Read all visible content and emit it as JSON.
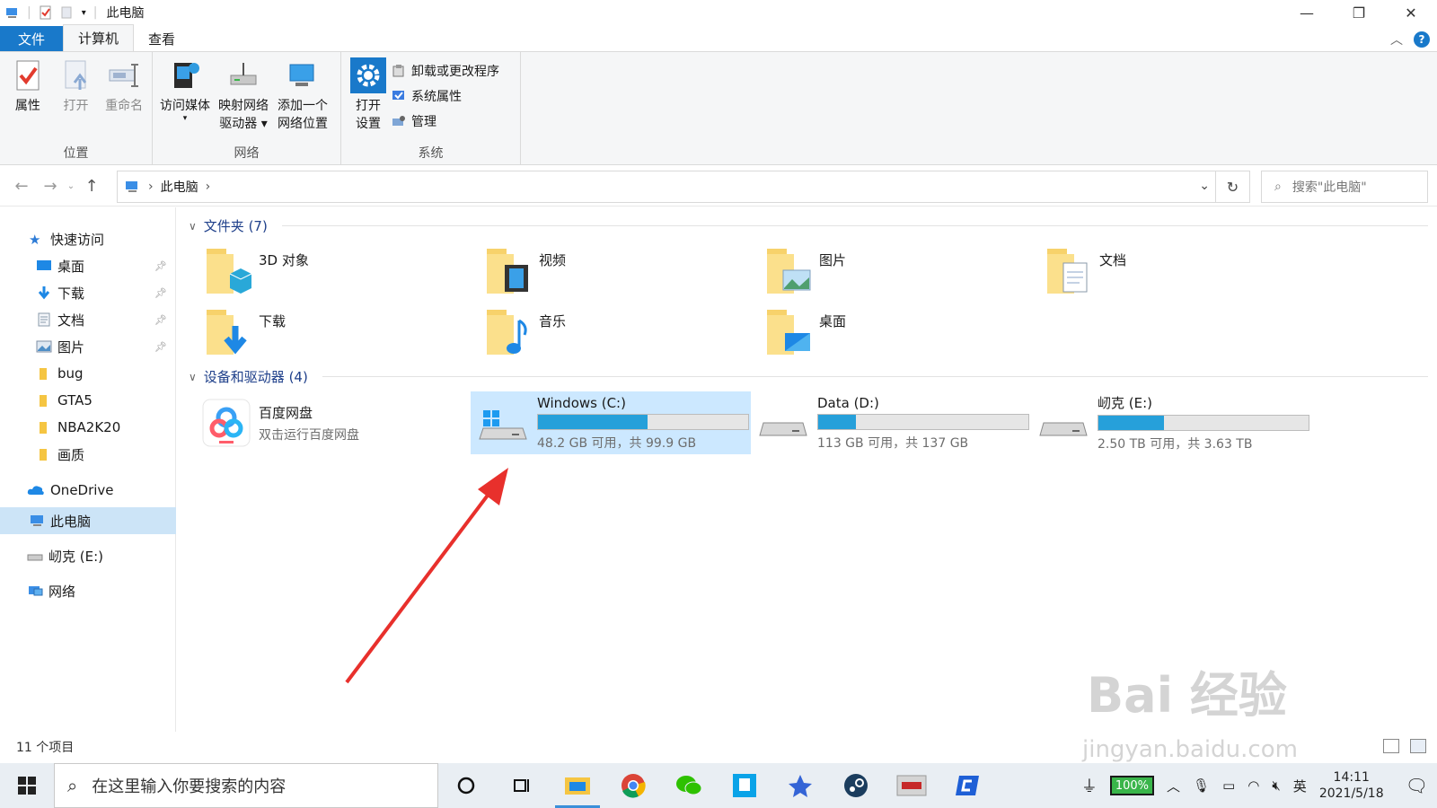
{
  "window": {
    "title": "此电脑",
    "controls": [
      "minimize",
      "restore",
      "close"
    ]
  },
  "ribbon_tabs": [
    {
      "label": "文件",
      "style": "file"
    },
    {
      "label": "计算机",
      "style": "active"
    },
    {
      "label": "查看",
      "style": "normal"
    }
  ],
  "ribbon": {
    "location": {
      "label": "位置",
      "buttons": [
        {
          "label": "属性",
          "icon": "properties-icon",
          "disabled": false
        },
        {
          "label": "打开",
          "icon": "open-icon",
          "disabled": true
        },
        {
          "label": "重命名",
          "icon": "rename-icon",
          "disabled": true
        }
      ]
    },
    "network": {
      "label": "网络",
      "buttons": [
        {
          "label": "访问媒体",
          "icon": "media-icon",
          "dropdown": true
        },
        {
          "label": "映射网络\n驱动器",
          "label_line1": "映射网络",
          "label_line2": "驱动器",
          "icon": "map-drive-icon",
          "dropdown": true
        },
        {
          "label_line1": "添加一个",
          "label_line2": "网络位置",
          "icon": "add-network-location-icon"
        }
      ]
    },
    "system": {
      "label": "系统",
      "open_settings_line1": "打开",
      "open_settings_line2": "设置",
      "items": [
        {
          "label": "卸载或更改程序",
          "icon": "uninstall-icon"
        },
        {
          "label": "系统属性",
          "icon": "system-properties-icon"
        },
        {
          "label": "管理",
          "icon": "manage-icon"
        }
      ]
    }
  },
  "address": {
    "path": "此电脑",
    "search_placeholder": "搜索\"此电脑\""
  },
  "sidebar": {
    "quick_access": "快速访问",
    "pinned": [
      {
        "label": "桌面",
        "icon": "desktop-icon",
        "pinned": true
      },
      {
        "label": "下载",
        "icon": "download-icon",
        "pinned": true
      },
      {
        "label": "文档",
        "icon": "documents-icon",
        "pinned": true
      },
      {
        "label": "图片",
        "icon": "pictures-icon",
        "pinned": true
      },
      {
        "label": "bug",
        "icon": "folder-icon",
        "pinned": false
      },
      {
        "label": "GTA5",
        "icon": "folder-icon",
        "pinned": false
      },
      {
        "label": "NBA2K20",
        "icon": "folder-icon",
        "pinned": false
      },
      {
        "label": "画质",
        "icon": "folder-icon",
        "pinned": false
      }
    ],
    "onedrive": "OneDrive",
    "this_pc": "此电脑",
    "drive_e": "屻克 (E:)",
    "network": "网络"
  },
  "folders_section": {
    "title": "文件夹 (7)",
    "items": [
      {
        "name": "3D 对象",
        "icon": "3d-objects-icon"
      },
      {
        "name": "视频",
        "icon": "videos-icon"
      },
      {
        "name": "图片",
        "icon": "pictures-icon"
      },
      {
        "name": "文档",
        "icon": "documents-icon"
      },
      {
        "name": "下载",
        "icon": "download-icon"
      },
      {
        "name": "音乐",
        "icon": "music-icon"
      },
      {
        "name": "桌面",
        "icon": "desktop-icon"
      }
    ]
  },
  "devices_section": {
    "title": "设备和驱动器 (4)",
    "baidu": {
      "name": "百度网盘",
      "subtitle": "双击运行百度网盘"
    },
    "drives": [
      {
        "name": "Windows (C:)",
        "free_text": "48.2 GB 可用，共 99.9 GB",
        "used_fraction": 0.52,
        "selected": true,
        "windows": true
      },
      {
        "name": "Data (D:)",
        "free_text": "113 GB 可用，共 137 GB",
        "used_fraction": 0.18,
        "selected": false,
        "windows": false
      },
      {
        "name": "屻克 (E:)",
        "free_text": "2.50 TB 可用，共 3.63 TB",
        "used_fraction": 0.31,
        "selected": false,
        "windows": false
      }
    ]
  },
  "status": {
    "count": "11 个项目"
  },
  "taskbar": {
    "search_placeholder": "在这里输入你要搜索的内容",
    "battery": "100%",
    "ime": "英",
    "time": "14:11",
    "date": "2021/5/18"
  },
  "watermark": {
    "line1": "Bai 经验",
    "line2": "jingyan.baidu.com"
  },
  "colors": {
    "accent": "#1979ca",
    "drive_bar": "#26a0da",
    "selection": "#cce8ff",
    "arrow": "#e8302c"
  }
}
